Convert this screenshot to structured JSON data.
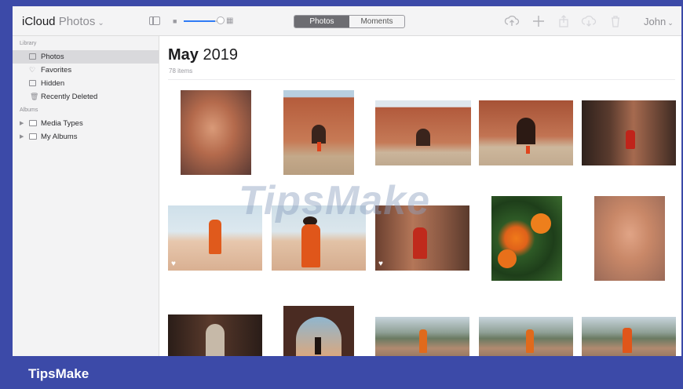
{
  "toolbar": {
    "app_name": "iCloud",
    "app_section": "Photos",
    "tabs": [
      {
        "label": "Photos",
        "active": true
      },
      {
        "label": "Moments",
        "active": false
      }
    ],
    "user_name": "John",
    "icons": [
      "sidebar-toggle-icon",
      "upload-icon",
      "add-icon",
      "share-icon",
      "download-icon",
      "trash-icon"
    ]
  },
  "sidebar": {
    "library_heading": "Library",
    "library_items": [
      {
        "label": "Photos",
        "selected": true,
        "icon": "photos-icon"
      },
      {
        "label": "Favorites",
        "selected": false,
        "icon": "heart-icon"
      },
      {
        "label": "Hidden",
        "selected": false,
        "icon": "hidden-icon"
      },
      {
        "label": "Recently Deleted",
        "selected": false,
        "icon": "trash-icon"
      }
    ],
    "albums_heading": "Albums",
    "album_items": [
      {
        "label": "Media Types"
      },
      {
        "label": "My Albums"
      }
    ]
  },
  "main": {
    "month": "May",
    "year": "2019",
    "item_count": "78 items",
    "photos": [
      {
        "subject": "blurred portrait",
        "favorite": false
      },
      {
        "subject": "mughal gateway",
        "favorite": false
      },
      {
        "subject": "red sandstone tomb",
        "favorite": false
      },
      {
        "subject": "arched courtyard",
        "favorite": false
      },
      {
        "subject": "woman in red on steps",
        "favorite": false
      },
      {
        "subject": "dancer in orange",
        "favorite": true
      },
      {
        "subject": "woman in orange from behind",
        "favorite": false
      },
      {
        "subject": "woman at lattice window",
        "favorite": true
      },
      {
        "subject": "orange marigolds",
        "favorite": false
      },
      {
        "subject": "blurred portrait",
        "favorite": false
      },
      {
        "subject": "dark archway",
        "favorite": false
      },
      {
        "subject": "silhouette in arch",
        "favorite": false
      },
      {
        "subject": "terrace view",
        "favorite": false
      },
      {
        "subject": "terrace view",
        "favorite": false
      },
      {
        "subject": "terrace view",
        "favorite": false
      }
    ]
  },
  "watermark": "TipsMake",
  "footer": {
    "brand": "TipsMake"
  },
  "colors": {
    "frame": "#3c4aa8",
    "accent": "#2f7bf5",
    "selected_row": "#d9d9dc"
  }
}
